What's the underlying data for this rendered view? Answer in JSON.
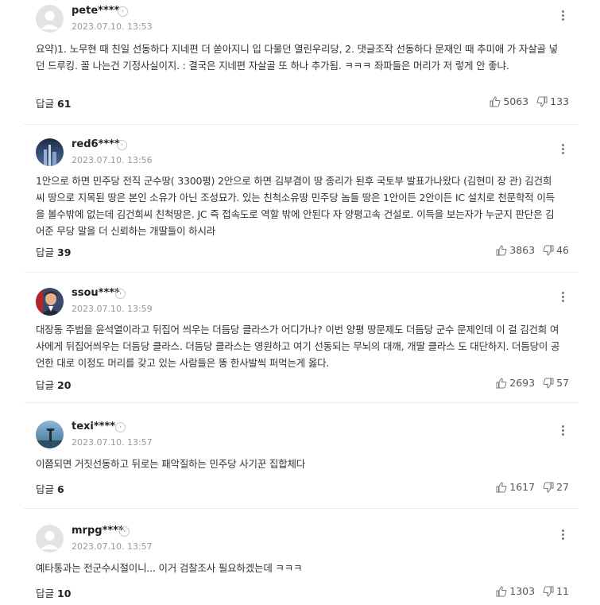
{
  "comments": [
    {
      "nick": "pete****",
      "date": "2023.07.10. 13:53",
      "text": "요약)1. 노무현 때 친일 선동하다 지네편 더 쏟아지니 입 다물던 열린우리당, 2. 댓글조작 선동하다 문재인 때 추미애 가 자살골 넣던 드루킹. 꼴 나는건 기정사실이지. : 결국은 지네편 자살골 또 하나 추가됨. ㅋㅋㅋ 좌파들은 머리가 저 렇게 안 좋냐.",
      "reply_label": "답글",
      "reply_count": "61",
      "likes": "5063",
      "dislikes": "133",
      "avatar": "default"
    },
    {
      "nick": "red6****",
      "date": "2023.07.10. 13:56",
      "text": "1안으로 하면 민주당 전직 군수땅( 3300평) 2안으로 하면 김부겸이 땅 종리가 된후 국토부 발표가나왔다 (김현미 장 관) 김건희씨 땅으로 지목된 땅은 본인 소유가 아닌 조성묘가. 있는 친척소유땅 민주당 놈들 땅은 1안이든 2안이든 IC 설치로 천문학적 이득을 볼수밖에 없는데 김건희씨 친척땅은. JC 즉 접속도로 역할 밖에 안된다 자 양평고속 건설로. 이득을 보는자가 누군지 판단은 김어준 무당 말을 더 신뢰하는 개딸들이 하시라",
      "reply_label": "답글",
      "reply_count": "39",
      "likes": "3863",
      "dislikes": "46",
      "avatar": "city"
    },
    {
      "nick": "ssou****",
      "date": "2023.07.10. 13:59",
      "text": "대장동 주범을 윤석열이라고 뒤집어 씌우는 더듬당 클라스가 어디가나? 이번 양평 땅문제도 더듬당 군수 문제인데 이 걸 김건희 여사에게 뒤집어씌우는 더듬당 클라스. 더듬당 클라스는 영원하고 여기 선동되는 무뇌의 대깨, 개딸 클라스 도 대단하지. 더듬당이 공언한 대로 이정도 머리를 갖고 있는 사람들은 똥 한사발씩 퍼먹는게 옳다.",
      "reply_label": "답글",
      "reply_count": "20",
      "likes": "2693",
      "dislikes": "57",
      "avatar": "portrait"
    },
    {
      "nick": "texi****",
      "date": "2023.07.10. 13:57",
      "text": "이쯤되면 거짓선동하고 뒤로는 패악질하는 민주당 사기꾼 집합체다",
      "reply_label": "답글",
      "reply_count": "6",
      "likes": "1617",
      "dislikes": "27",
      "avatar": "sky"
    },
    {
      "nick": "mrpg****",
      "date": "2023.07.10. 13:57",
      "text": "예타통과는 전군수시절이니... 이거 검찰조사 필요하겠는데 ㅋㅋㅋ",
      "reply_label": "답글",
      "reply_count": "10",
      "likes": "1303",
      "dislikes": "11",
      "avatar": "default"
    }
  ]
}
